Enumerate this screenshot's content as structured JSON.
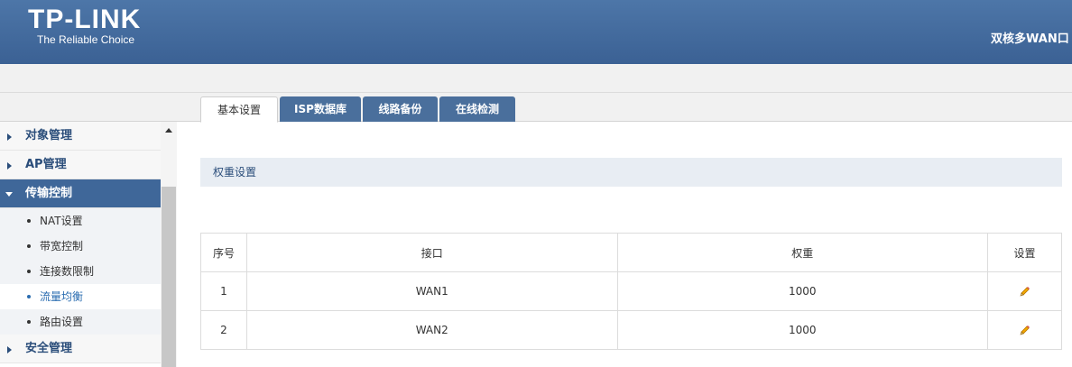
{
  "header": {
    "logo": "TP-LINK",
    "tagline": "The Reliable Choice",
    "product": "双核多WAN口"
  },
  "tabs": [
    {
      "label": "基本设置",
      "active": true
    },
    {
      "label": "ISP数据库",
      "active": false
    },
    {
      "label": "线路备份",
      "active": false
    },
    {
      "label": "在线检测",
      "active": false
    }
  ],
  "sidebar": {
    "menus": [
      {
        "label": "对象管理",
        "expanded": false
      },
      {
        "label": "AP管理",
        "expanded": false
      },
      {
        "label": "传输控制",
        "expanded": true
      },
      {
        "label": "安全管理",
        "expanded": false
      }
    ],
    "submenu": [
      {
        "label": "NAT设置"
      },
      {
        "label": "带宽控制"
      },
      {
        "label": "连接数限制"
      },
      {
        "label": "流量均衡",
        "active": true
      },
      {
        "label": "路由设置"
      }
    ]
  },
  "section": {
    "title": "权重设置"
  },
  "table": {
    "columns": [
      "序号",
      "接口",
      "权重",
      "设置"
    ],
    "rows": [
      {
        "index": "1",
        "interface": "WAN1",
        "weight": "1000",
        "action_icon": "edit-icon"
      },
      {
        "index": "2",
        "interface": "WAN2",
        "weight": "1000",
        "action_icon": "edit-icon"
      }
    ]
  },
  "colors": {
    "header": "#3f6799",
    "accent": "#2a4d7a",
    "active_link": "#2a6cb0"
  }
}
